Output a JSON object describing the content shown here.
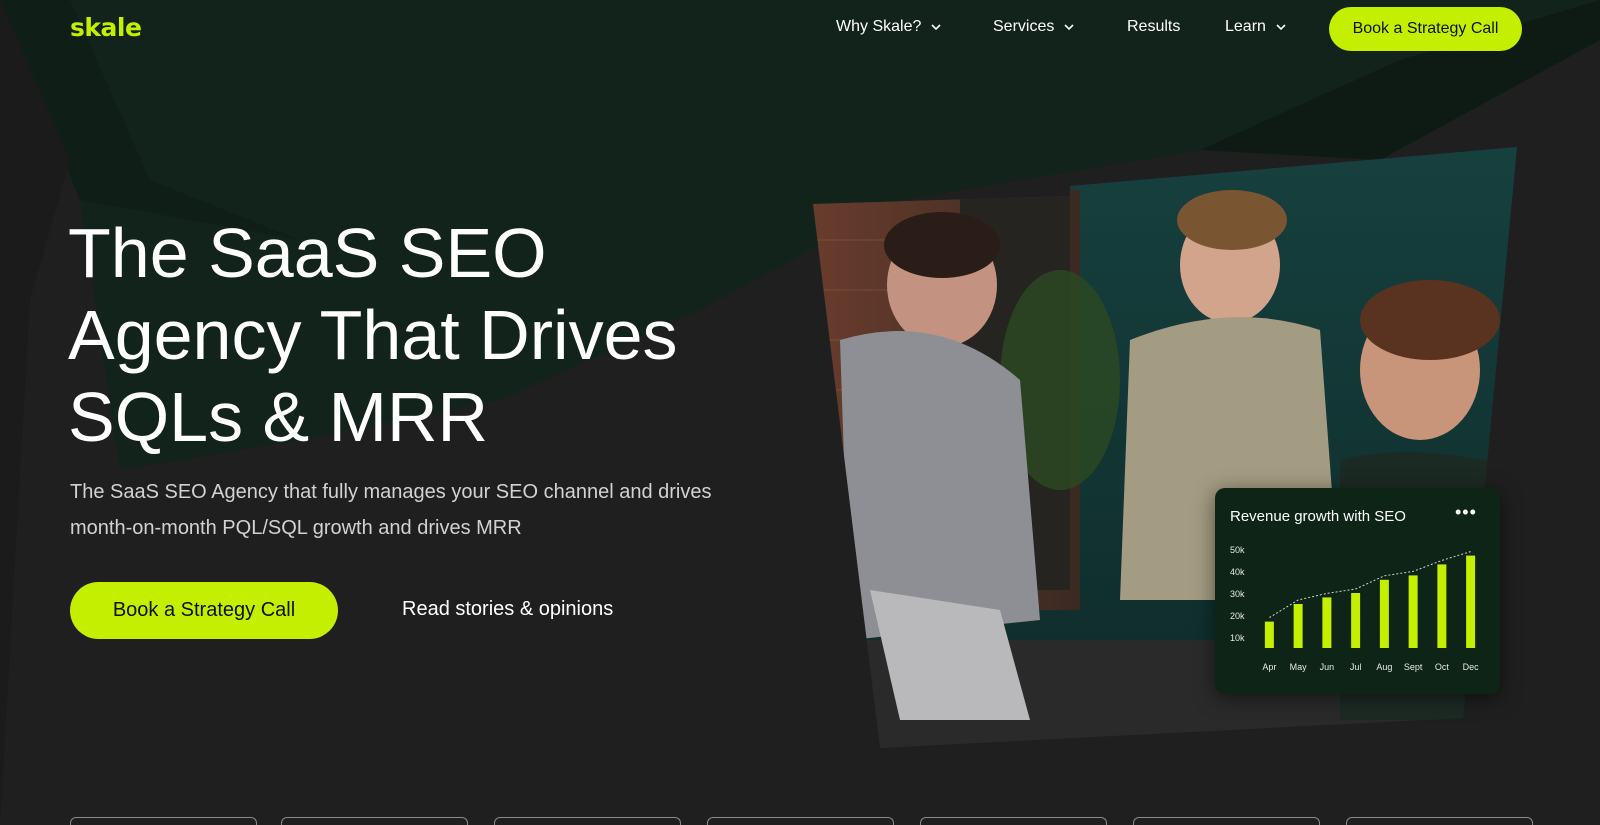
{
  "brand": {
    "logo_text": "skale",
    "accent": "#c4f000"
  },
  "nav": {
    "items": [
      {
        "label": "Why Skale?",
        "has_dropdown": true
      },
      {
        "label": "Services",
        "has_dropdown": true
      },
      {
        "label": "Results",
        "has_dropdown": false
      },
      {
        "label": "Learn",
        "has_dropdown": true
      }
    ],
    "cta_label": "Book a Strategy Call"
  },
  "hero": {
    "title_lines": [
      "The SaaS SEO",
      "Agency That Drives",
      "SQLs & MRR"
    ],
    "subtitle_lines": [
      "The SaaS SEO Agency that fully manages your SEO channel and drives",
      "month-on-month PQL/SQL growth and drives MRR"
    ],
    "primary_cta": "Book a Strategy Call",
    "secondary_link": "Read stories & opinions"
  },
  "revenue_card": {
    "title": "Revenue growth with SEO",
    "menu_icon": "more-dots-icon"
  },
  "chart_data": {
    "type": "bar",
    "title": "Revenue growth with SEO",
    "categories": [
      "Apr",
      "May",
      "Jun",
      "Jul",
      "Aug",
      "Sept",
      "Oct",
      "Dec"
    ],
    "values": [
      17,
      25,
      28,
      30,
      36,
      38,
      43,
      47
    ],
    "ytick_labels": [
      "50k",
      "40k",
      "30k",
      "20k",
      "10k"
    ],
    "ylim": [
      5,
      55
    ],
    "trend_line": true,
    "color": "#c4f000",
    "grid": false,
    "legend": false
  },
  "logo_strip": {
    "tile_count": 7
  }
}
